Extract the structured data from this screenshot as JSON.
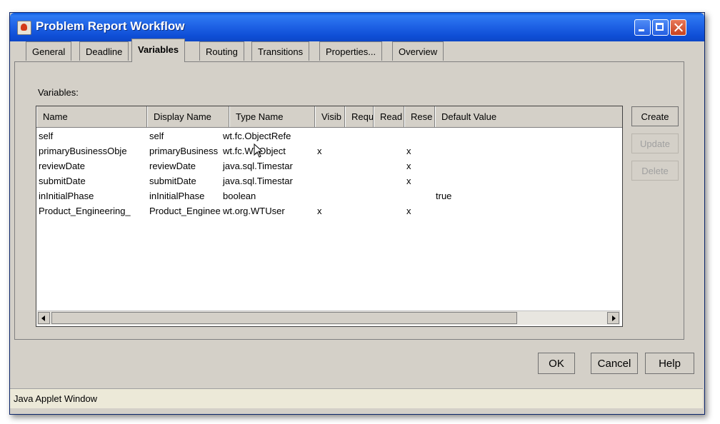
{
  "window": {
    "title": "Problem Report Workflow"
  },
  "tabs": [
    {
      "label": "General",
      "active": false
    },
    {
      "label": "Deadline",
      "active": false
    },
    {
      "label": "Variables",
      "active": true
    },
    {
      "label": "Routing",
      "active": false
    },
    {
      "label": "Transitions",
      "active": false
    },
    {
      "label": "Properties...",
      "active": false
    },
    {
      "label": "Overview",
      "active": false
    }
  ],
  "variables": {
    "section_label": "Variables:",
    "columns": [
      "Name",
      "Display Name",
      "Type Name",
      "Visib",
      "Requ",
      "Read",
      "Rese",
      "Default Value"
    ],
    "rows": [
      [
        "self",
        "self",
        "wt.fc.ObjectRefe",
        "",
        "",
        "",
        "",
        ""
      ],
      [
        "primaryBusinessObje",
        "primaryBusiness",
        "wt.fc.WTObject",
        "x",
        "",
        "",
        "x",
        ""
      ],
      [
        "reviewDate",
        "reviewDate",
        "java.sql.Timestar",
        "",
        "",
        "",
        "x",
        ""
      ],
      [
        "submitDate",
        "submitDate",
        "java.sql.Timestar",
        "",
        "",
        "",
        "x",
        ""
      ],
      [
        "inInitialPhase",
        "inInitialPhase",
        "boolean",
        "",
        "",
        "",
        "",
        "true"
      ],
      [
        "Product_Engineering_",
        "Product_Enginee",
        "wt.org.WTUser",
        "x",
        "",
        "",
        "x",
        ""
      ]
    ]
  },
  "side_buttons": {
    "create": "Create",
    "update": "Update",
    "delete": "Delete"
  },
  "footer_buttons": {
    "ok": "OK",
    "cancel": "Cancel",
    "help": "Help"
  },
  "status_bar": {
    "text": "Java Applet Window"
  }
}
